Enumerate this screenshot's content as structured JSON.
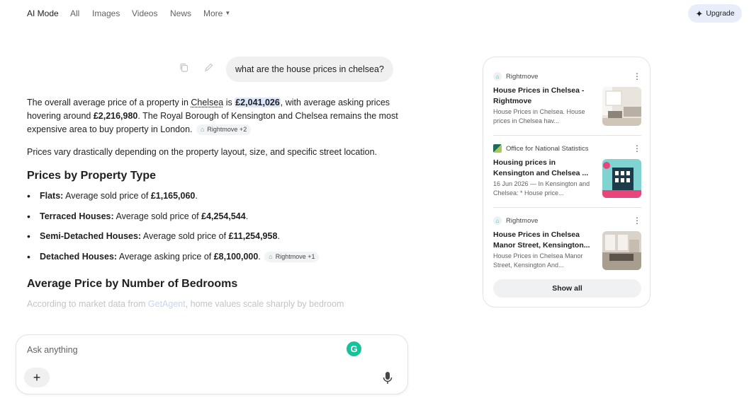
{
  "nav": {
    "tabs": [
      {
        "label": "AI Mode"
      },
      {
        "label": "All"
      },
      {
        "label": "Images"
      },
      {
        "label": "Videos"
      },
      {
        "label": "News"
      },
      {
        "label": "More"
      }
    ],
    "upgrade_label": "Upgrade"
  },
  "query": "what are the house prices in chelsea?",
  "answer": {
    "p1": {
      "t1": "The overall average price of a property in ",
      "place": "Chelsea",
      "t2": " is ",
      "avg": "£2,041,026",
      "t3": ", with average asking prices hovering around ",
      "asking": "£2,216,980",
      "t4": ". The Royal Borough of Kensington and Chelsea remains the most expensive area to buy property in London.",
      "chip": "Rightmove +2"
    },
    "p2": "Prices vary drastically depending on the property layout, size, and specific street location.",
    "h_type": "Prices by Property Type",
    "types": [
      {
        "name": "Flats:",
        "text": " Average sold price of ",
        "value": "£1,165,060",
        "end": "."
      },
      {
        "name": "Terraced Houses:",
        "text": " Average sold price of ",
        "value": "£4,254,544",
        "end": "."
      },
      {
        "name": "Semi-Detached Houses:",
        "text": " Average sold price of ",
        "value": "£11,254,958",
        "end": "."
      },
      {
        "name": "Detached Houses:",
        "text": " Average asking price of ",
        "value": "£8,100,000",
        "end": "."
      }
    ],
    "types_chip": "Rightmove +1",
    "h_bed": "Average Price by Number of Bedrooms",
    "faded": {
      "t1": "According to market data from ",
      "link": "GetAgent",
      "t2": ", home values scale sharply by bedroom"
    }
  },
  "ask": {
    "placeholder": "Ask anything"
  },
  "sources": [
    {
      "site": "Rightmove",
      "title": "House Prices in Chelsea - Rightmove",
      "snippet": "House Prices in Chelsea. House prices in Chelsea hav..."
    },
    {
      "site": "Office for National Statistics",
      "title": "Housing prices in Kensington and Chelsea ...",
      "snippet": "16 Jun 2026 — In Kensington and Chelsea: * House price..."
    },
    {
      "site": "Rightmove",
      "title": "House Prices in Chelsea Manor Street, Kensington...",
      "snippet": "House Prices in Chelsea Manor Street, Kensington And..."
    }
  ],
  "show_all_label": "Show all",
  "colors": {
    "accent_chip": "#dce7fb",
    "upgrade_bg": "#e8eef9",
    "grammarly": "#15c39a"
  }
}
